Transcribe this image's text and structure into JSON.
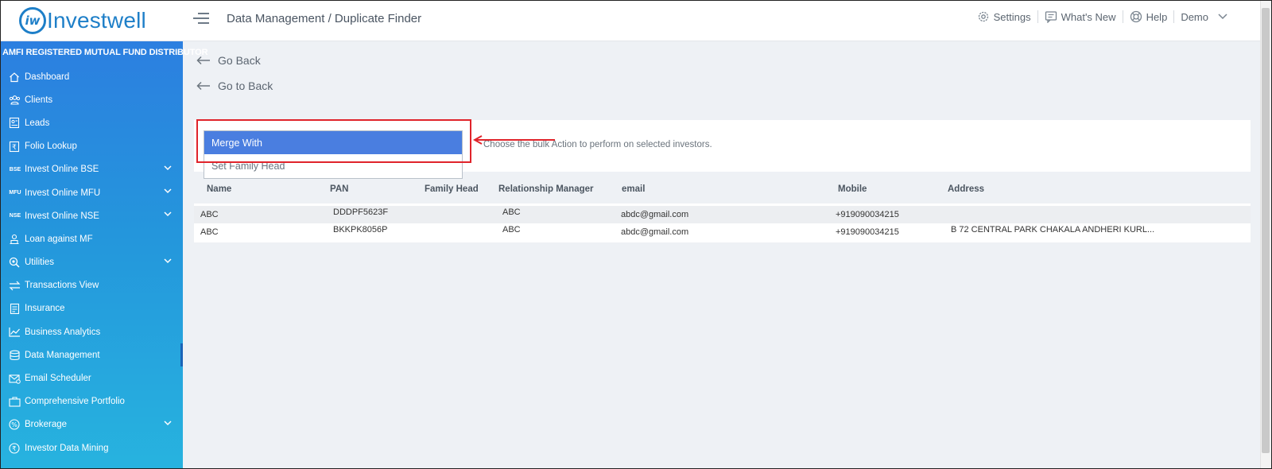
{
  "header": {
    "logo_badge": "iw",
    "logo_text": "Investwell",
    "breadcrumb": "Data Management / Duplicate Finder",
    "settings": "Settings",
    "whats_new": "What's New",
    "help": "Help",
    "user": "Demo"
  },
  "sidebar": {
    "title": "AMFI REGISTERED MUTUAL FUND DISTRIBUTOR",
    "items": [
      {
        "label": "Dashboard",
        "icon": "home-icon"
      },
      {
        "label": "Clients",
        "icon": "users-icon"
      },
      {
        "label": "Leads",
        "icon": "leads-icon"
      },
      {
        "label": "Folio Lookup",
        "icon": "rupee-doc-icon"
      },
      {
        "label": "Invest Online BSE",
        "icon_text": "BSE"
      },
      {
        "label": "Invest Online MFU",
        "icon_text": "MFU"
      },
      {
        "label": "Invest Online NSE",
        "icon_text": "NSE"
      },
      {
        "label": "Loan against MF",
        "icon": "loan-icon"
      },
      {
        "label": "Utilities",
        "icon": "utilities-icon"
      },
      {
        "label": "Transactions View",
        "icon": "transfer-icon"
      },
      {
        "label": "Insurance",
        "icon": "insurance-icon"
      },
      {
        "label": "Business Analytics",
        "icon": "analytics-icon"
      },
      {
        "label": "Data Management",
        "icon": "data-icon"
      },
      {
        "label": "Email Scheduler",
        "icon": "email-icon"
      },
      {
        "label": "Comprehensive Portfolio",
        "icon": "portfolio-icon"
      },
      {
        "label": "Brokerage",
        "icon": "percent-icon"
      },
      {
        "label": "Investor Data Mining",
        "icon": "mining-icon"
      }
    ]
  },
  "main": {
    "go_back": "Go Back",
    "go_to_back": "Go to Back",
    "action_hint": "Choose the bulk Action to perform on selected investors.",
    "dropdown": {
      "options": [
        "Merge With",
        "Set Family Head"
      ],
      "selected": "Merge With"
    },
    "table": {
      "columns": [
        "Name",
        "PAN",
        "Family Head",
        "Relationship Manager",
        "email",
        "Mobile",
        "Address"
      ],
      "rows": [
        {
          "name": "ABC",
          "pan": "DDDPF5623F",
          "family_head": "",
          "rm": "ABC",
          "email": "abdc@gmail.com",
          "mobile": "+919090034215",
          "address": ""
        },
        {
          "name": "ABC",
          "pan": "BKKPK8056P",
          "family_head": "",
          "rm": "ABC",
          "email": "abdc@gmail.com",
          "mobile": "+919090034215",
          "address": "B 72 CENTRAL PARK CHAKALA ANDHERI KURL..."
        }
      ]
    }
  },
  "colors": {
    "brand": "#1e7fc8",
    "sidebar_top": "#2c7fe0",
    "sidebar_bottom": "#27b3df",
    "dropdown_selected": "#4a7ee0",
    "highlight": "#e0242b"
  }
}
